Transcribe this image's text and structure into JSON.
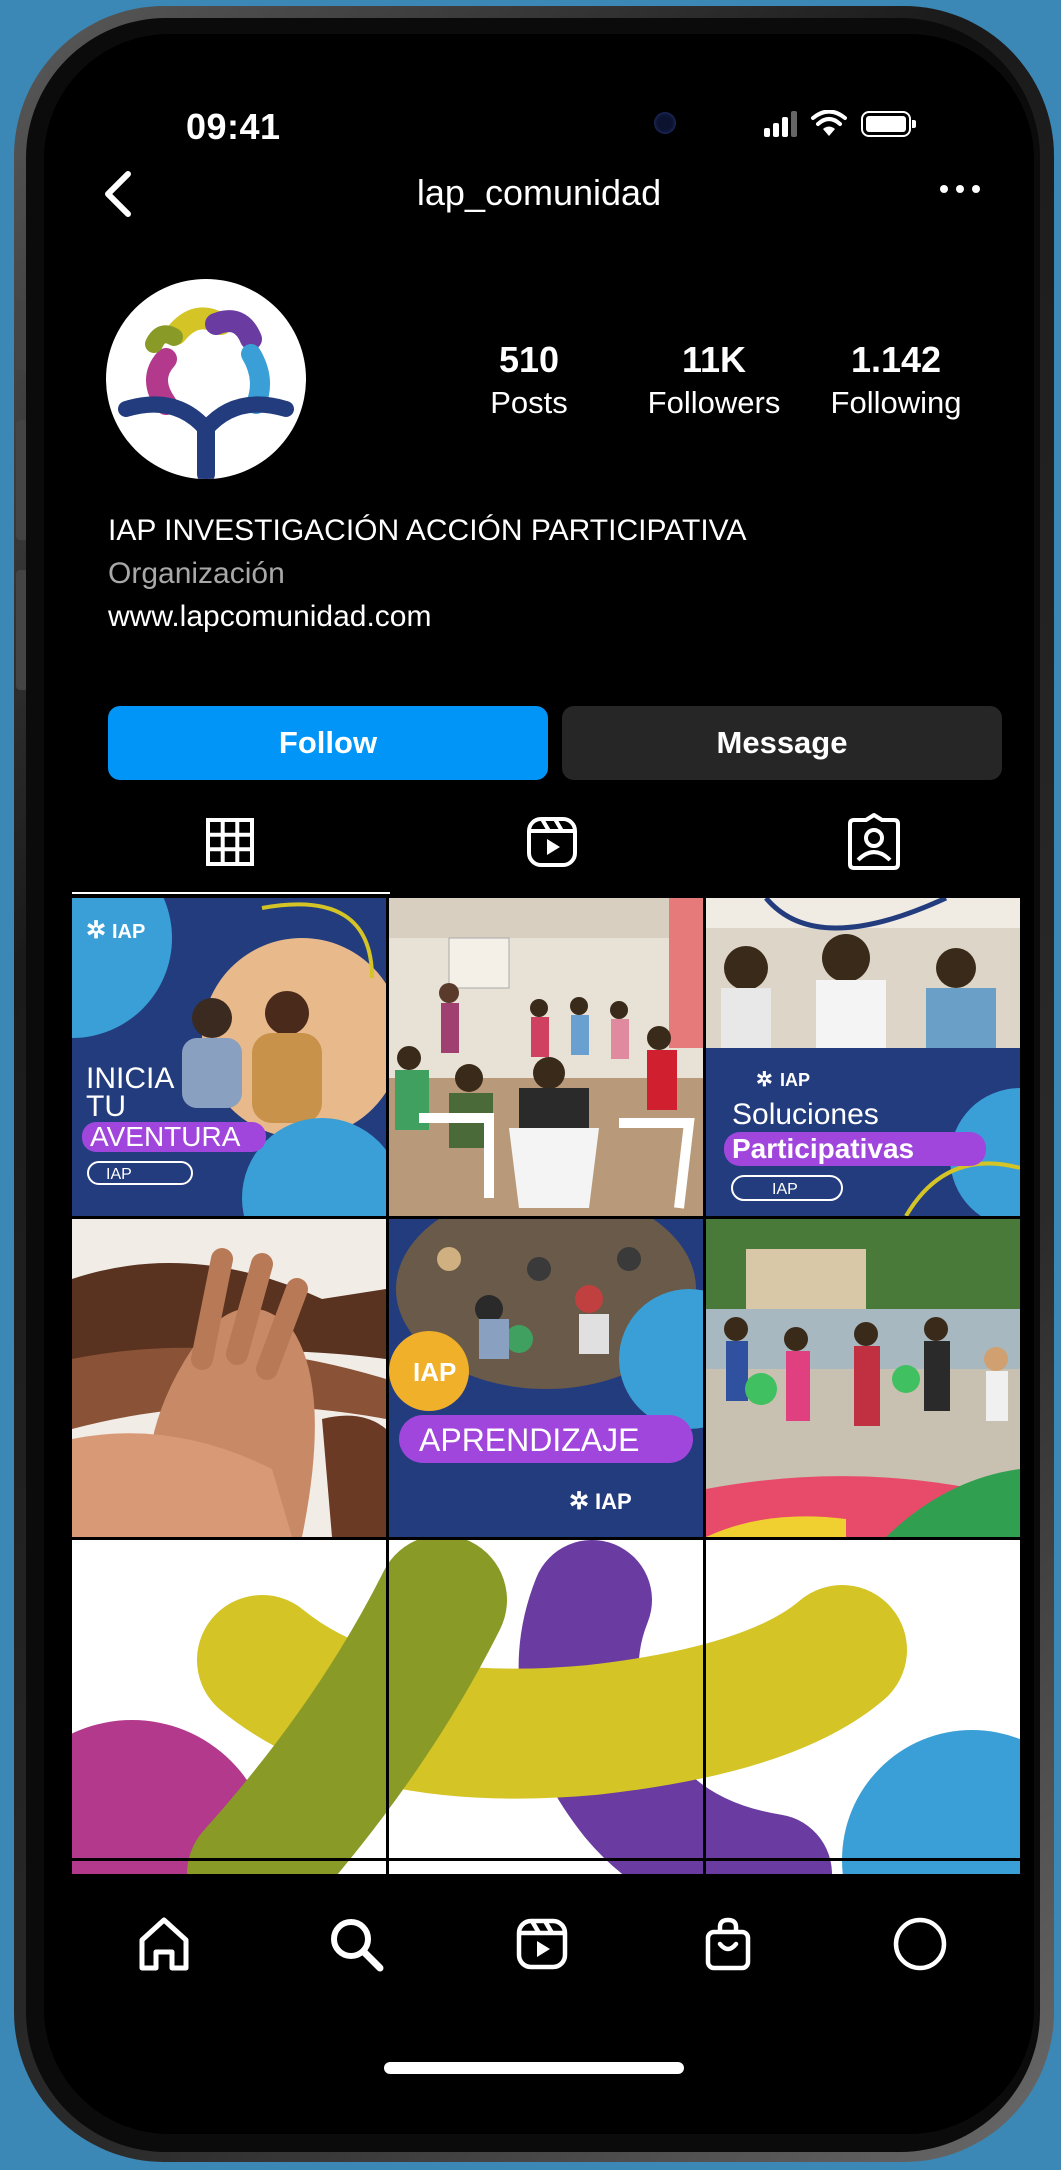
{
  "status_bar": {
    "time": "09:41"
  },
  "header": {
    "username": "lap_comunidad"
  },
  "profile": {
    "stats": [
      {
        "value": "510",
        "label": "Posts"
      },
      {
        "value": "11K",
        "label": "Followers"
      },
      {
        "value": "1.142",
        "label": "Following"
      }
    ],
    "name": "IAP INVESTIGACIÓN ACCIÓN PARTICIPATIVA",
    "category": "Organización",
    "website": "www.lapcomunidad.com"
  },
  "actions": {
    "follow_label": "Follow",
    "message_label": "Message"
  },
  "tabs": [
    "grid-icon",
    "reels-icon",
    "tagged-icon"
  ],
  "posts": {
    "post1": {
      "line1": "INICIA",
      "line2": "TU",
      "line3": "AVENTURA",
      "badge": "IAP",
      "logo": "IAP"
    },
    "post3": {
      "line1": "Soluciones",
      "line2": "Participativas",
      "badge": "IAP",
      "logo": "IAP"
    },
    "post5": {
      "badge": "IAP",
      "banner": "APRENDIZAJE",
      "logo": "IAP"
    }
  },
  "bottom_nav": [
    "home-icon",
    "search-icon",
    "reels-icon",
    "shop-icon",
    "profile-icon"
  ],
  "colors": {
    "background": "#3b87b5",
    "accent_blue": "#0095f6",
    "navy": "#233c7e",
    "purple": "#a046dc",
    "olive": "#8a9a26",
    "yellow": "#d4c425",
    "magenta": "#b3398c",
    "cyan": "#3a9fd6"
  }
}
